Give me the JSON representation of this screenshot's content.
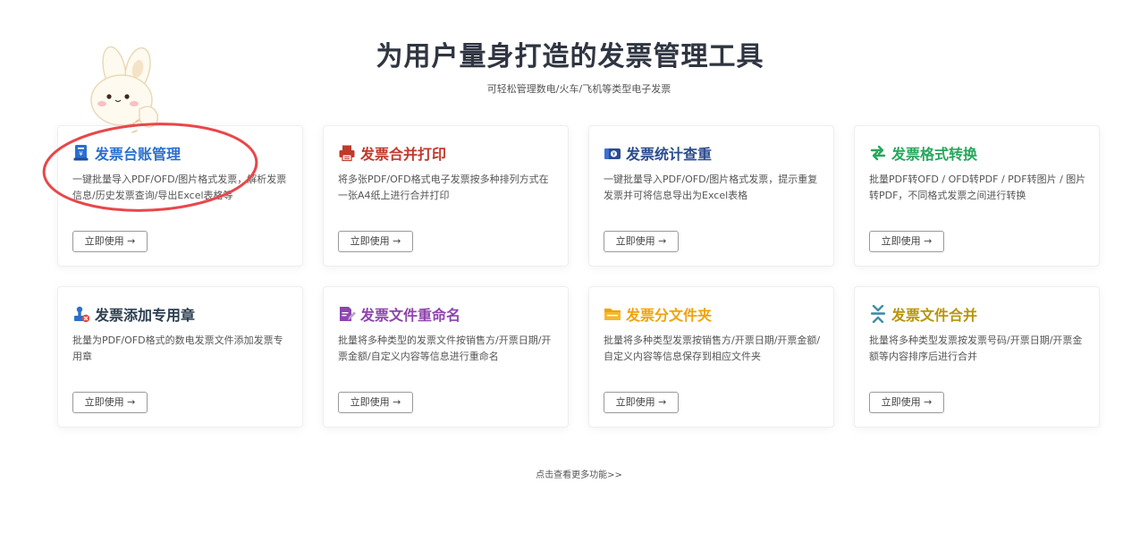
{
  "header": {
    "title": "为用户量身打造的发票管理工具",
    "subtitle": "可轻松管理数电/火车/飞机等类型电子发票"
  },
  "cards": [
    {
      "title": "发票台账管理",
      "desc": "一键批量导入PDF/OFD/图片格式发票，解析发票信息/历史发票查询/导出Excel表格等",
      "button": "立即使用 →",
      "color": "#2a6fcf",
      "icon": "ledger-icon"
    },
    {
      "title": "发票合并打印",
      "desc": "将多张PDF/OFD格式电子发票按多种排列方式在一张A4纸上进行合并打印",
      "button": "立即使用 →",
      "color": "#c0392b",
      "icon": "printer-icon"
    },
    {
      "title": "发票统计查重",
      "desc": "一键批量导入PDF/OFD/图片格式发票，提示重复发票并可将信息导出为Excel表格",
      "button": "立即使用 →",
      "color": "#2a4b8d",
      "icon": "wallet-icon"
    },
    {
      "title": "发票格式转换",
      "desc": "批量PDF转OFD / OFD转PDF / PDF转图片 / 图片转PDF，不同格式发票之间进行转换",
      "button": "立即使用 →",
      "color": "#27a75c",
      "icon": "swap-arrows-icon"
    },
    {
      "title": "发票添加专用章",
      "desc": "批量为PDF/OFD格式的数电发票文件添加发票专用章",
      "button": "立即使用 →",
      "color": "#2c3e50",
      "icon": "stamp-icon"
    },
    {
      "title": "发票文件重命名",
      "desc": "批量将多种类型的发票文件按销售方/开票日期/开票金额/自定义内容等信息进行重命名",
      "button": "立即使用 →",
      "color": "#8e44ad",
      "icon": "edit-file-icon"
    },
    {
      "title": "发票分文件夹",
      "desc": "批量将多种类型发票按销售方/开票日期/开票金额/自定义内容等信息保存到相应文件夹",
      "button": "立即使用 →",
      "color": "#f0a30a",
      "icon": "folder-icon"
    },
    {
      "title": "发票文件合并",
      "desc": "批量将多种类型发票按发票号码/开票日期/开票金额等内容排序后进行合并",
      "button": "立即使用 →",
      "color": "#b7950b",
      "icon": "merge-icon"
    }
  ],
  "footer": {
    "more": "点击查看更多功能>>"
  },
  "colors": {
    "annotation": "#e8474a",
    "title": "#2f3541"
  }
}
